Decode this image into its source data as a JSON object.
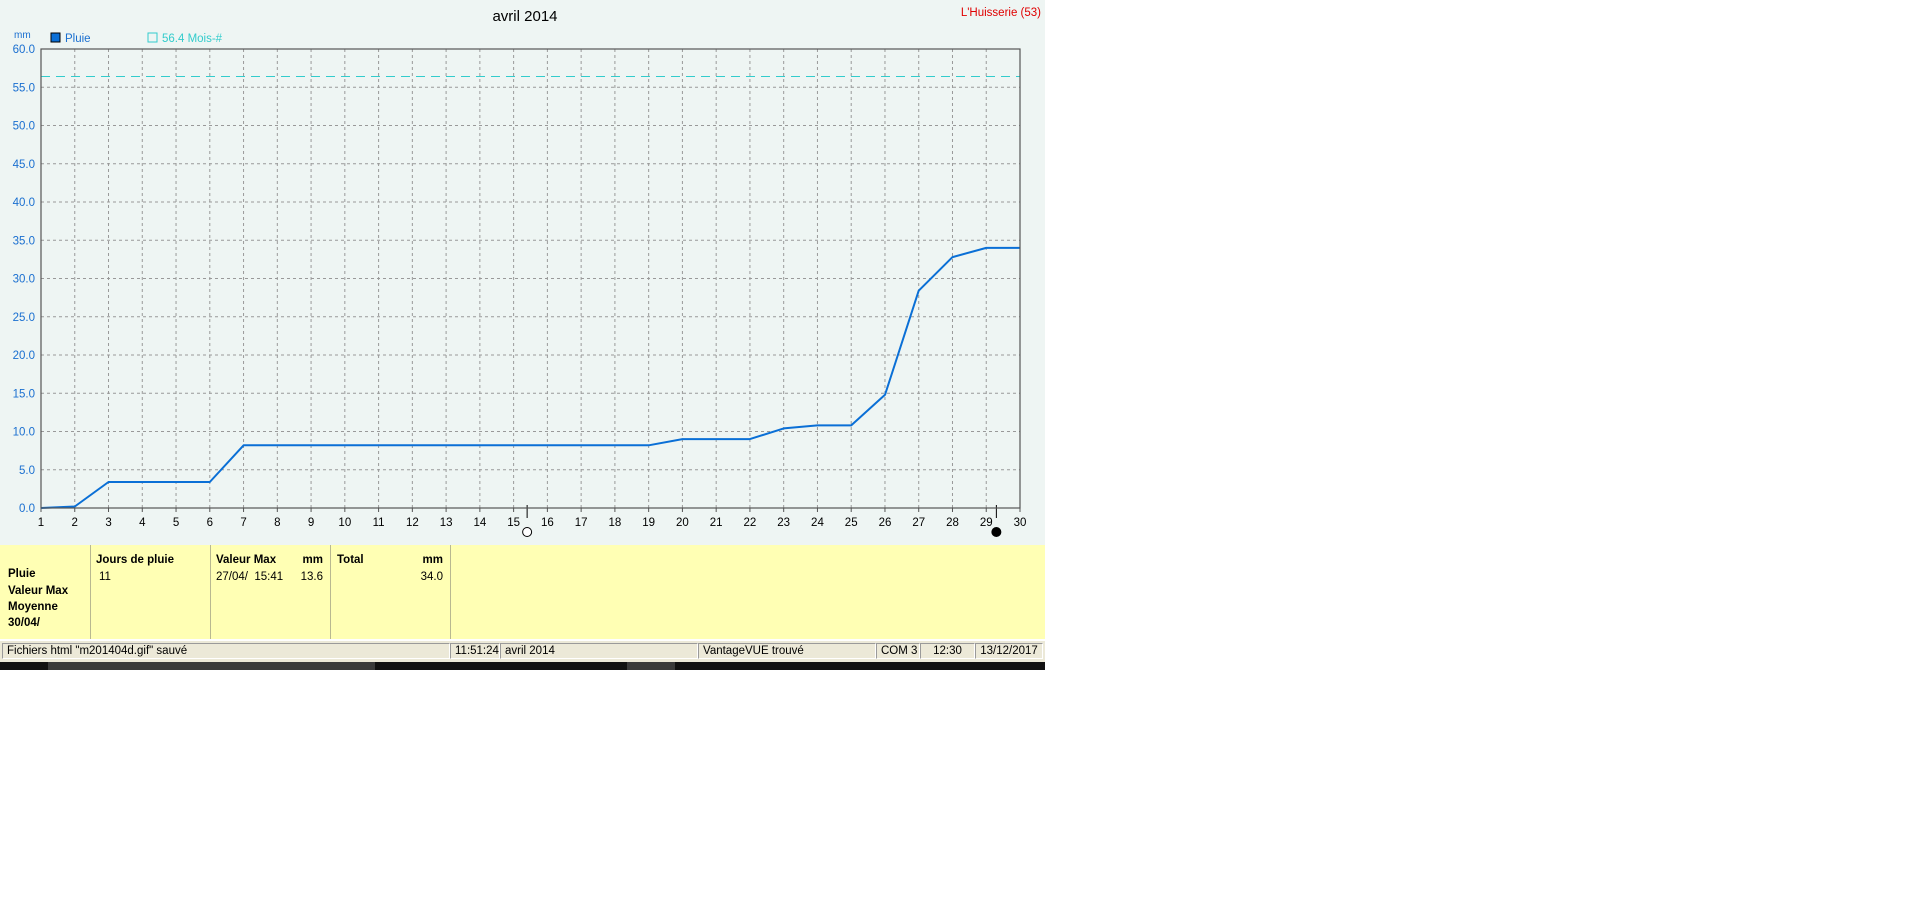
{
  "header": {
    "title": "avril 2014",
    "station": "L'Huisserie (53)",
    "unit": "mm"
  },
  "legend": {
    "series_label": "Pluie",
    "reference_label": "56.4 Mois-#"
  },
  "colors": {
    "series": "#0a6fd6",
    "reference": "#33cccc",
    "station": "#e00000",
    "axis_text": "#1a6fd0",
    "panel_bg": "#ffffb4"
  },
  "chart_data": {
    "type": "line",
    "title": "avril 2014",
    "ylabel": "mm",
    "ylim": [
      0,
      60
    ],
    "yticks": [
      "0.0",
      "5.0",
      "10.0",
      "15.0",
      "20.0",
      "25.0",
      "30.0",
      "35.0",
      "40.0",
      "45.0",
      "50.0",
      "55.0",
      "60.0"
    ],
    "xlim": [
      1,
      30
    ],
    "xticks": [
      "1",
      "2",
      "3",
      "4",
      "5",
      "6",
      "7",
      "8",
      "9",
      "10",
      "11",
      "12",
      "13",
      "14",
      "15",
      "16",
      "17",
      "18",
      "19",
      "20",
      "21",
      "22",
      "23",
      "24",
      "25",
      "26",
      "27",
      "28",
      "29",
      "30"
    ],
    "grid": true,
    "series": [
      {
        "name": "Pluie",
        "x": [
          1,
          2,
          3,
          4,
          5,
          6,
          7,
          8,
          9,
          10,
          11,
          12,
          13,
          14,
          15,
          16,
          17,
          18,
          19,
          20,
          21,
          22,
          23,
          24,
          25,
          26,
          27,
          28,
          29,
          30
        ],
        "values": [
          0.0,
          0.2,
          3.4,
          3.4,
          3.4,
          3.4,
          8.2,
          8.2,
          8.2,
          8.2,
          8.2,
          8.2,
          8.2,
          8.2,
          8.2,
          8.2,
          8.2,
          8.2,
          8.2,
          9.0,
          9.0,
          9.0,
          10.4,
          10.8,
          10.8,
          14.8,
          28.4,
          32.8,
          34.0,
          34.0
        ]
      }
    ],
    "reference_line": {
      "name": "56.4 Mois-#",
      "value": 56.4
    },
    "moon_markers": [
      {
        "x": 15.4,
        "phase": "full-moon-icon"
      },
      {
        "x": 29.3,
        "phase": "new-moon-icon"
      }
    ]
  },
  "stats": {
    "row_labels": [
      "Pluie",
      "Valeur Max",
      "Moyenne",
      "30/04/"
    ],
    "rain_days": {
      "header": "Jours de pluie",
      "value": "11"
    },
    "max_value": {
      "header": "Valeur Max",
      "unit": "mm",
      "datetime": "27/04/  15:41",
      "value": "13.6"
    },
    "total": {
      "header": "Total",
      "unit": "mm",
      "value": "34.0"
    }
  },
  "statusbar": {
    "message": "Fichiers html  \"m201404d.gif\"  sauvé",
    "time": "11:51:24",
    "period": "avril 2014",
    "device": "VantageVUE trouvé",
    "port": "COM 3",
    "clock": "12:30",
    "date": "13/12/2017"
  }
}
